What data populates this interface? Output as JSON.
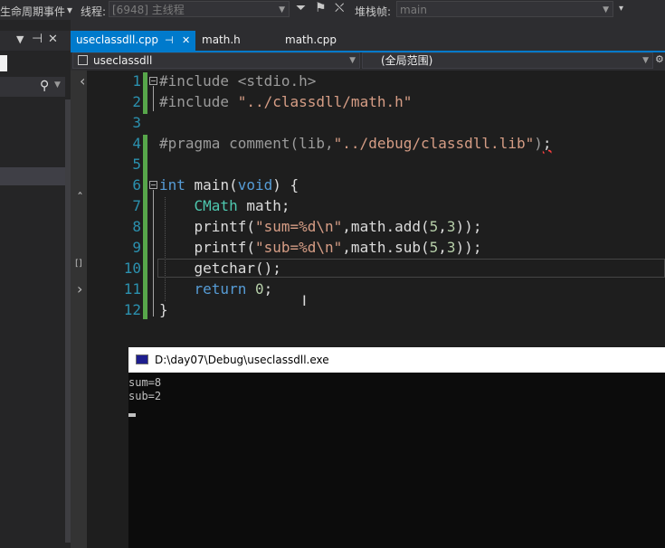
{
  "toolbar": {
    "lifecycle_label": "生命周期事件",
    "thread_label": "线程:",
    "thread_value": "[6948] 主线程",
    "stack_label": "堆栈帧:",
    "stack_value": "main"
  },
  "tabs": [
    {
      "label": "useclassdll.cpp",
      "pin": "⊣",
      "close": "✕"
    },
    {
      "label": "math.h"
    },
    {
      "label": "math.cpp"
    }
  ],
  "nav": {
    "project": "useclassdll",
    "scope": "(全局范围)"
  },
  "editor": {
    "line_numbers": [
      "1",
      "2",
      "3",
      "4",
      "5",
      "6",
      "7",
      "8",
      "9",
      "10",
      "11",
      "12"
    ]
  },
  "console": {
    "title": "D:\\day07\\Debug\\useclassdll.exe",
    "output": "sum=8\nsub=2"
  },
  "colors": {
    "accent": "#007acc",
    "editor_bg": "#1e1e1e",
    "keyword": "#569cd6",
    "string": "#d69d85",
    "type": "#4ec9b0",
    "number": "#b5cea8",
    "line_number": "#2b91af",
    "change_bar": "#57a64a"
  }
}
